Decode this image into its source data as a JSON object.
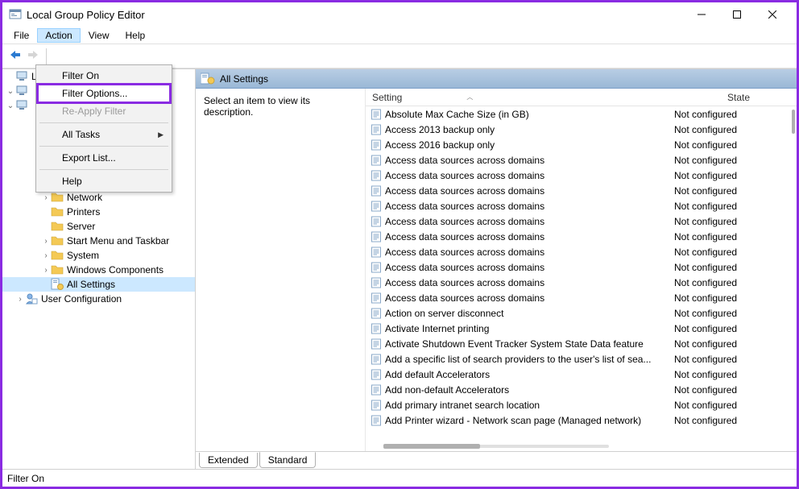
{
  "window": {
    "title": "Local Group Policy Editor"
  },
  "menubar": [
    "File",
    "Action",
    "View",
    "Help"
  ],
  "menubar_active_index": 1,
  "context_menu": {
    "items": [
      {
        "label": "Filter On",
        "disabled": false,
        "sep_after": false,
        "highlight": false,
        "submenu": false
      },
      {
        "label": "Filter Options...",
        "disabled": false,
        "sep_after": false,
        "highlight": true,
        "submenu": false
      },
      {
        "label": "Re-Apply Filter",
        "disabled": true,
        "sep_after": true,
        "highlight": false,
        "submenu": false
      },
      {
        "label": "All Tasks",
        "disabled": false,
        "sep_after": true,
        "highlight": false,
        "submenu": true
      },
      {
        "label": "Export List...",
        "disabled": false,
        "sep_after": true,
        "highlight": false,
        "submenu": false
      },
      {
        "label": "Help",
        "disabled": false,
        "sep_after": false,
        "highlight": false,
        "submenu": false
      }
    ]
  },
  "tree": {
    "hidden_top": "Lo",
    "visible_nodes": [
      {
        "indent": 2,
        "expander": ">",
        "icon": "folder",
        "label": "Network",
        "selected": false
      },
      {
        "indent": 2,
        "expander": "",
        "icon": "folder",
        "label": "Printers",
        "selected": false
      },
      {
        "indent": 2,
        "expander": "",
        "icon": "folder",
        "label": "Server",
        "selected": false
      },
      {
        "indent": 2,
        "expander": ">",
        "icon": "folder",
        "label": "Start Menu and Taskbar",
        "selected": false
      },
      {
        "indent": 2,
        "expander": ">",
        "icon": "folder",
        "label": "System",
        "selected": false
      },
      {
        "indent": 2,
        "expander": ">",
        "icon": "folder",
        "label": "Windows Components",
        "selected": false
      },
      {
        "indent": 2,
        "expander": "",
        "icon": "allsettings",
        "label": "All Settings",
        "selected": true
      },
      {
        "indent": 0,
        "expander": ">",
        "icon": "userconfig",
        "label": "User Configuration",
        "selected": false
      }
    ],
    "peek_rows": [
      {
        "indent": 0,
        "expander": "v",
        "icon": "computer"
      },
      {
        "indent": 0,
        "expander": "v",
        "icon": "computer"
      }
    ]
  },
  "content": {
    "header_label": "All Settings",
    "description_prompt": "Select an item to view its description.",
    "columns": {
      "setting": "Setting",
      "state": "State"
    },
    "rows": [
      {
        "name": "Absolute Max Cache Size (in GB)",
        "state": "Not configured"
      },
      {
        "name": "Access 2013 backup only",
        "state": "Not configured"
      },
      {
        "name": "Access 2016 backup only",
        "state": "Not configured"
      },
      {
        "name": "Access data sources across domains",
        "state": "Not configured"
      },
      {
        "name": "Access data sources across domains",
        "state": "Not configured"
      },
      {
        "name": "Access data sources across domains",
        "state": "Not configured"
      },
      {
        "name": "Access data sources across domains",
        "state": "Not configured"
      },
      {
        "name": "Access data sources across domains",
        "state": "Not configured"
      },
      {
        "name": "Access data sources across domains",
        "state": "Not configured"
      },
      {
        "name": "Access data sources across domains",
        "state": "Not configured"
      },
      {
        "name": "Access data sources across domains",
        "state": "Not configured"
      },
      {
        "name": "Access data sources across domains",
        "state": "Not configured"
      },
      {
        "name": "Access data sources across domains",
        "state": "Not configured"
      },
      {
        "name": "Action on server disconnect",
        "state": "Not configured"
      },
      {
        "name": "Activate Internet printing",
        "state": "Not configured"
      },
      {
        "name": "Activate Shutdown Event Tracker System State Data feature",
        "state": "Not configured"
      },
      {
        "name": "Add a specific list of search providers to the user's list of sea...",
        "state": "Not configured"
      },
      {
        "name": "Add default Accelerators",
        "state": "Not configured"
      },
      {
        "name": "Add non-default Accelerators",
        "state": "Not configured"
      },
      {
        "name": "Add primary intranet search location",
        "state": "Not configured"
      },
      {
        "name": "Add Printer wizard - Network scan page (Managed network)",
        "state": "Not configured"
      }
    ]
  },
  "tabs": {
    "extended": "Extended",
    "standard": "Standard",
    "active": "standard"
  },
  "statusbar": {
    "text": "Filter On"
  }
}
